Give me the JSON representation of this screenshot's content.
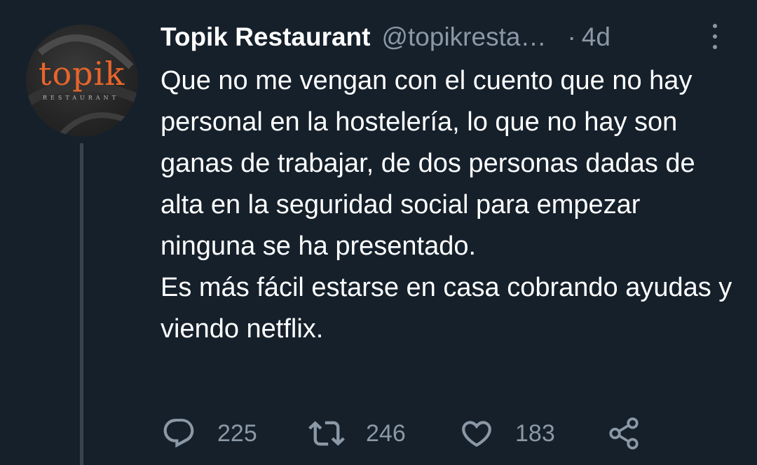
{
  "tweet": {
    "display_name": "Topik Restaurant",
    "handle": "@topikresta…",
    "separator": "·",
    "time": "4d",
    "text_paragraphs": [
      "Que no me vengan con el cuento que no hay personal en la hostelería, lo que no hay son ganas de trabajar, de dos personas dadas de alta en la seguridad social para empezar ninguna se ha presentado.",
      "Es más fácil estarse en casa cobrando ayudas y viendo netflix."
    ],
    "avatar": {
      "logo_text": "topik",
      "logo_subtext": "RESTAURANT"
    },
    "actions": {
      "replies": "225",
      "retweets": "246",
      "likes": "183"
    }
  },
  "colors": {
    "background": "#15202b",
    "text_primary": "#ffffff",
    "text_secondary": "#8b98a5",
    "thread_line": "#38444d",
    "logo_accent": "#e8652a"
  },
  "icons": [
    "reply-icon",
    "retweet-icon",
    "like-icon",
    "share-icon",
    "more-options-icon"
  ]
}
